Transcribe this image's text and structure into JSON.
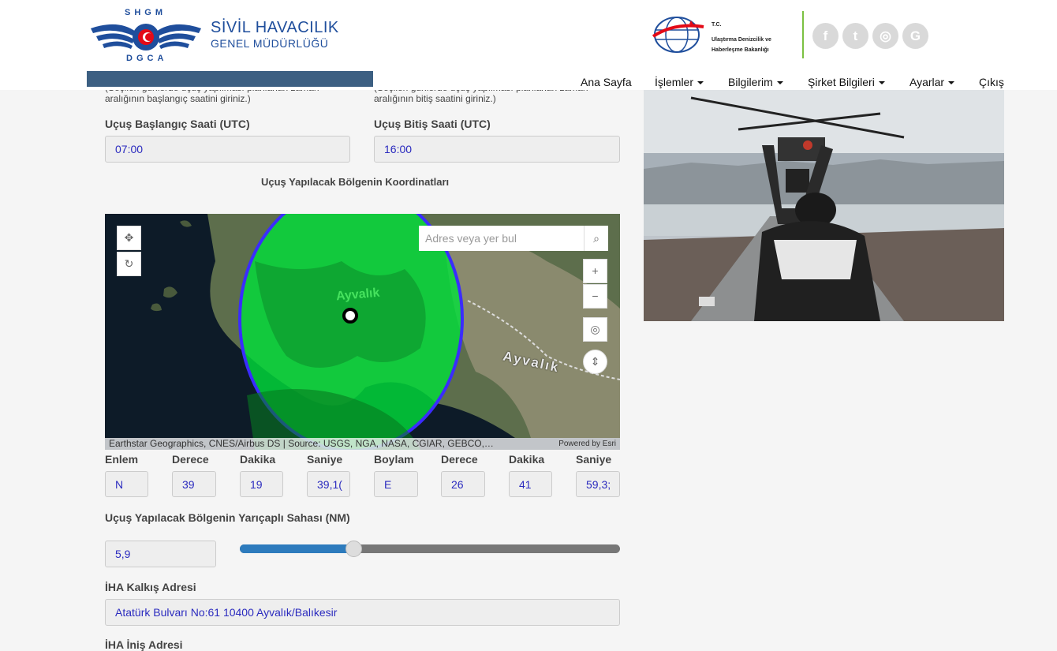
{
  "header": {
    "logo_top": "SHGM",
    "logo_bottom": "DGCA",
    "brand_line1": "SİVİL HAVACILIK",
    "brand_line2": "GENEL MÜDÜRLÜĞÜ",
    "ministry_line1": "T.C.",
    "ministry_line2": "Ulaştırma Denizcilik ve Haberleşme Bakanlığı",
    "social": [
      {
        "icon": "facebook-icon",
        "glyph": "f"
      },
      {
        "icon": "twitter-icon",
        "glyph": "t"
      },
      {
        "icon": "instagram-icon",
        "glyph": "◎"
      },
      {
        "icon": "google-icon",
        "glyph": "G"
      }
    ]
  },
  "nav": {
    "home": "Ana Sayfa",
    "operations": "İşlemler",
    "my_info": "Bilgilerim",
    "company": "Şirket Bilgileri",
    "settings": "Ayarlar",
    "logout": "Çıkış"
  },
  "form": {
    "hint_start": "(Seçilen günlerde uçuş yapılması planlanan zaman aralığının başlangıç saatini giriniz.)",
    "hint_end": "(Seçilen günlerde uçuş yapılması planlanan zaman aralığının bitiş saatini giriniz.)",
    "start_label": "Uçuş Başlangıç Saati (UTC)",
    "start_value": "07:00",
    "end_label": "Uçuş Bitiş Saati (UTC)",
    "end_value": "16:00",
    "coords_title": "Uçuş Yapılacak Bölgenin Koordinatları",
    "coord_labels": [
      "Enlem",
      "Derece",
      "Dakika",
      "Saniye",
      "Boylam",
      "Derece",
      "Dakika",
      "Saniye"
    ],
    "coord_values": [
      "N",
      "39",
      "19",
      "39,1(",
      "E",
      "26",
      "41",
      "59,3;"
    ],
    "radius_label": "Uçuş Yapılacak Bölgenin Yarıçaplı Sahası (NM)",
    "radius_value": "5,9",
    "radius_level_percent": 29,
    "takeoff_label": "İHA Kalkış Adresi",
    "takeoff_value": "Atatürk Bulvarı  No:61  10400 Ayvalık/Balıkesir",
    "landing_label": "İHA İniş Adresi"
  },
  "map": {
    "search_placeholder": "Adres veya yer bul",
    "place_label": "Ayvalık",
    "place_label2": "Ayvalık",
    "attribution": "Earthstar Geographics, CNES/Airbus DS | Source: USGS, NGA, NASA, CGIAR, GEBCO,…",
    "powered": "Powered by Esri",
    "zone_color": "#00e03a",
    "zone_border": "#3a2cff"
  },
  "colors": {
    "brand_blue": "#1f4e9c",
    "input_text": "#2b2bbf",
    "slider_fill": "#2d7bbd",
    "accent_green": "#7bc142"
  }
}
